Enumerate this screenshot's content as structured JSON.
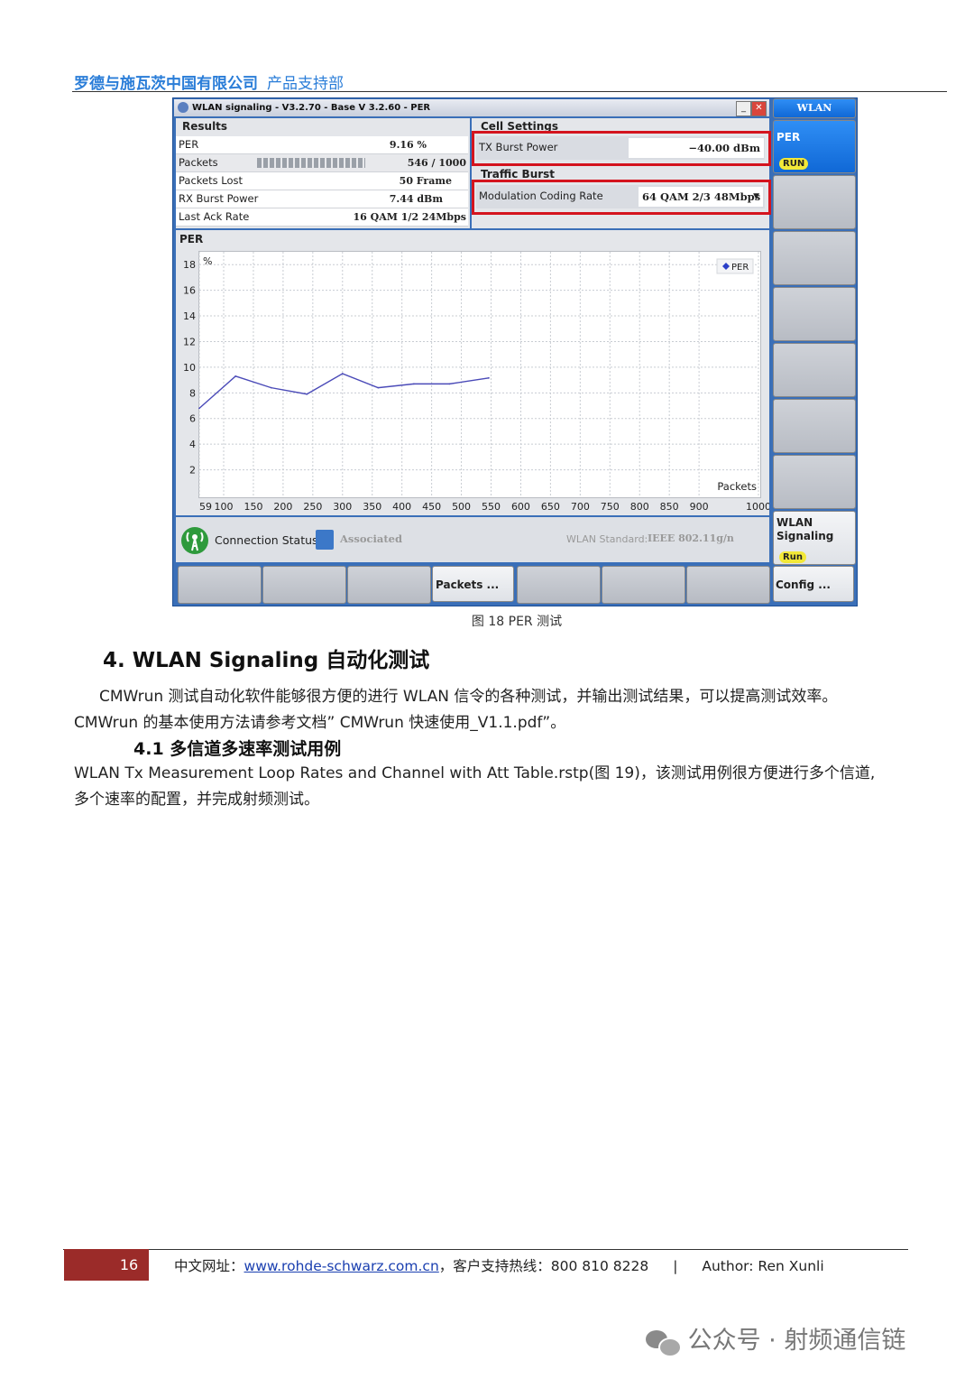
{
  "header": {
    "company": "罗德与施瓦茨中国有限公司",
    "dept": "产品支持部"
  },
  "screen": {
    "title": "WLAN signaling  - V3.2.70 - Base V 3.2.60 - PER",
    "results": {
      "heading": "Results",
      "rows": [
        {
          "label": "PER",
          "value": "9.16 %"
        },
        {
          "label": "Packets",
          "value": "546 / 1000"
        },
        {
          "label": "Packets Lost",
          "value": "50 Frame"
        },
        {
          "label": "RX Burst Power",
          "value": "7.44 dBm"
        },
        {
          "label": "Last Ack Rate",
          "value": "16 QAM 1/2 24Mbps"
        }
      ]
    },
    "cell_settings": {
      "heading": "Cell Settings",
      "tx_label": "TX Burst  Power",
      "tx_value": "−40.00  dBm",
      "traffic_heading": "Traffic Burst",
      "mod_label": "Modulation Coding Rate",
      "mod_value": "64 QAM 2/3 48Mbps"
    },
    "per_panel_title": "PER",
    "status": {
      "conn_label": "Connection Status:",
      "conn_value": "Associated",
      "std_label": "WLAN Standard:",
      "std_value": "IEEE 802.11g/n"
    },
    "softkeys": {
      "top_tab": "WLAN",
      "per_label": "PER",
      "run": "RUN",
      "wlan_sig_1": "WLAN",
      "wlan_sig_2": "Signaling",
      "run2": "Run",
      "config": "Config ..."
    },
    "bottom_keys": {
      "packets": "Packets ..."
    }
  },
  "chart_data": {
    "type": "line",
    "title": "",
    "ylabel": "%",
    "xlabel": "Packets",
    "xlim": [
      59,
      1000
    ],
    "ylim": [
      0,
      19
    ],
    "x_ticks": [
      "59",
      "100",
      "150",
      "200",
      "250",
      "300",
      "350",
      "400",
      "450",
      "500",
      "550",
      "600",
      "650",
      "700",
      "750",
      "800",
      "850",
      "900",
      "1000"
    ],
    "y_ticks": [
      "2",
      "4",
      "6",
      "8",
      "10",
      "12",
      "14",
      "16",
      "18"
    ],
    "series": [
      {
        "name": "PER",
        "x": [
          59,
          120,
          180,
          240,
          300,
          360,
          420,
          480,
          546
        ],
        "y": [
          6.8,
          9.3,
          8.4,
          7.9,
          9.5,
          8.4,
          8.7,
          8.7,
          9.16
        ]
      }
    ],
    "legend_position": "top-right",
    "grid": true,
    "line_color": "#4a4ab8"
  },
  "caption": "图 18 PER 测试",
  "section4": {
    "title": "4.  WLAN Signaling  自动化测试",
    "para1": "CMWrun 测试自动化软件能够很方便的进行 WLAN 信令的各种测试，并输出测试结果，可以提高测试效率。",
    "para2": "CMWrun 的基本使用方法请参考文档” CMWrun 快速使用_V1.1.pdf”。",
    "sub_title": "4.1 多信道多速率测试用例",
    "para3": "WLAN Tx Measurement Loop Rates and Channel with Att Table.rstp(图 19)，该测试用例很方便进行多个信道,",
    "para4": "多个速率的配置，并完成射频测试。"
  },
  "footer": {
    "page": "16",
    "site_label": "中文网址：",
    "site_url": "www.rohde-schwarz.com.cn",
    "hotline": "，客户支持热线：800 810 8228",
    "sep": "|",
    "author": "Author: Ren Xunli"
  },
  "watermark": "公众号 · 射频通信链"
}
